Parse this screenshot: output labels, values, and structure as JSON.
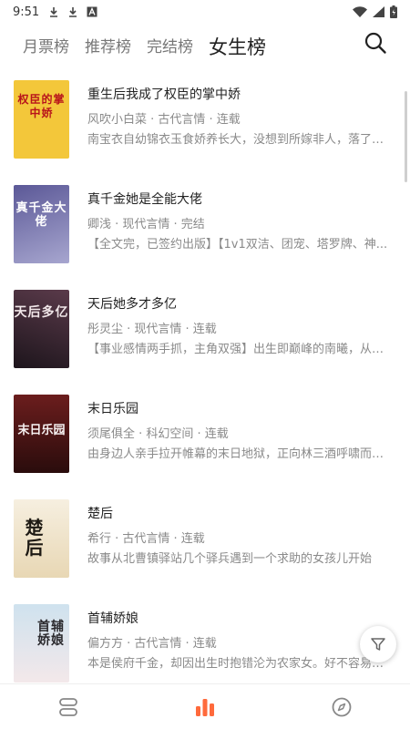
{
  "status_bar": {
    "time": "9:51",
    "icons_left": [
      "download-icon",
      "download-icon",
      "a-box-icon"
    ],
    "icons_right": [
      "wifi-icon",
      "signal-icon",
      "battery-icon"
    ]
  },
  "tabs": [
    {
      "label": "月票榜",
      "active": false
    },
    {
      "label": "推荐榜",
      "active": false
    },
    {
      "label": "完结榜",
      "active": false
    },
    {
      "label": "女生榜",
      "active": true
    }
  ],
  "colors": {
    "accent": "#ff6a3c",
    "text_primary": "#222222",
    "text_secondary": "#8a8a8a"
  },
  "books": [
    {
      "title": "重生后我成了权臣的掌中娇",
      "meta": "风吹小白菜 · 古代言情 · 连载",
      "desc": "南宝衣自幼锦衣玉食娇养长大，没想到所嫁非人，落了个..."
    },
    {
      "title": "真千金她是全能大佬",
      "meta": "卿浅 · 现代言情 · 完结",
      "desc": "【全文完，已签约出版】【1v1双洁、团宠、塔罗牌、神..."
    },
    {
      "title": "天后她多才多亿",
      "meta": "彤灵尘 · 现代言情 · 连载",
      "desc": "【事业感情两手抓，主角双强】出生即巅峰的南曦，从小..."
    },
    {
      "title": "末日乐园",
      "meta": "须尾俱全 · 科幻空间 · 连载",
      "desc": "由身边人亲手拉开帷幕的末日地狱，正向林三酒呼啸而来。"
    },
    {
      "title": "楚后",
      "meta": "希行 · 古代言情 · 连载",
      "desc": "故事从北曹镇驿站几个驿兵遇到一个求助的女孩儿开始"
    },
    {
      "title": "首辅娇娘",
      "meta": "偏方方 · 古代言情 · 连载",
      "desc": "本是侯府千金，却因出生时抱错沦为农家女。好不容易长..."
    }
  ],
  "covers": [
    {
      "text": "权臣的掌中娇",
      "bg": "#f3c73a",
      "fg": "#b8141b"
    },
    {
      "text": "真千金大佬",
      "bg": "#6d6aa6",
      "fg": "#ffffff"
    },
    {
      "text": "天后多亿",
      "bg": "#2c1f2d",
      "fg": "#f0e6e8"
    },
    {
      "text": "末日乐园",
      "bg": "#4a1414",
      "fg": "#f7f2f2"
    },
    {
      "text": "楚后",
      "bg": "#f3ead8",
      "fg": "#1e1a14"
    },
    {
      "text": "首辅娇娘",
      "bg": "#d9e7ef",
      "fg": "#2b2a2e"
    }
  ],
  "bottom_nav": [
    {
      "icon": "bookshelf-icon",
      "active": false
    },
    {
      "icon": "rank-icon",
      "active": true
    },
    {
      "icon": "compass-icon",
      "active": false
    }
  ]
}
